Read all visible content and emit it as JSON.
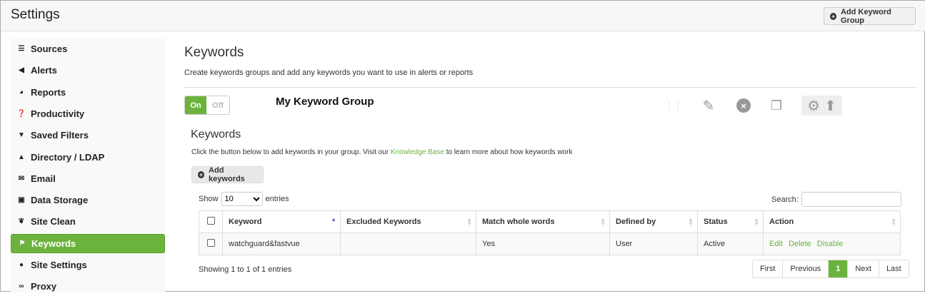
{
  "header": {
    "title": "Settings",
    "add_group_label": "Add Keyword Group"
  },
  "sidebar": {
    "items": [
      {
        "label": "Sources",
        "icon": "list-icon",
        "glyph": "☰"
      },
      {
        "label": "Alerts",
        "icon": "megaphone-icon",
        "glyph": "◀"
      },
      {
        "label": "Reports",
        "icon": "pie-chart-icon",
        "glyph": "◕"
      },
      {
        "label": "Productivity",
        "icon": "question-icon",
        "glyph": "❓"
      },
      {
        "label": "Saved Filters",
        "icon": "filter-icon",
        "glyph": "▼"
      },
      {
        "label": "Directory / LDAP",
        "icon": "user-icon",
        "glyph": "▲"
      },
      {
        "label": "Email",
        "icon": "envelope-icon",
        "glyph": "✉"
      },
      {
        "label": "Data Storage",
        "icon": "inbox-icon",
        "glyph": "▣"
      },
      {
        "label": "Site Clean",
        "icon": "leaf-icon",
        "glyph": "❦"
      },
      {
        "label": "Keywords",
        "icon": "flag-icon",
        "glyph": "⚑",
        "active": true
      },
      {
        "label": "Site Settings",
        "icon": "globe-icon",
        "glyph": "●"
      },
      {
        "label": "Proxy",
        "icon": "link-icon",
        "glyph": "∞"
      }
    ]
  },
  "main": {
    "title": "Keywords",
    "description": "Create keywords groups and add any keywords you want to use in alerts or reports",
    "group": {
      "on_label": "On",
      "off_label": "Off",
      "name": "My Keyword Group"
    },
    "section_title": "Keywords",
    "help_pre": "Click the button below to add keywords in your group. Visit our ",
    "help_link": "Knowledge Base",
    "help_post": " to learn more about how keywords work",
    "add_keywords_label": "Add keywords",
    "show_label": "Show",
    "show_value": "10",
    "entries_label": "entries",
    "search_label": "Search:",
    "search_value": "",
    "columns": [
      "Keyword",
      "Excluded Keywords",
      "Match whole words",
      "Defined by",
      "Status",
      "Action"
    ],
    "rows": [
      {
        "keyword": "watchguard&fastvue",
        "excluded": "",
        "match": "Yes",
        "defined_by": "User",
        "status": "Active",
        "actions": [
          "Edit",
          "Delete",
          "Disable"
        ]
      }
    ],
    "info": "Showing 1 to 1 of 1 entries",
    "pager": {
      "first": "First",
      "previous": "Previous",
      "current": "1",
      "next": "Next",
      "last": "Last"
    }
  },
  "colors": {
    "accent": "#6cb33e"
  }
}
